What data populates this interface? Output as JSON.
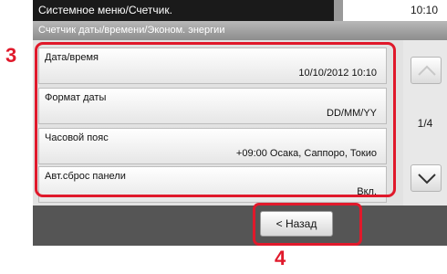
{
  "header": {
    "title": "Системное меню/Счетчик.",
    "time": "10:10",
    "subtitle": "Счетчик даты/времени/Эконом. энергии"
  },
  "settings": [
    {
      "label": "Дата/время",
      "value": "10/10/2012 10:10"
    },
    {
      "label": "Формат даты",
      "value": "DD/MM/YY"
    },
    {
      "label": "Часовой пояс",
      "value": "+09:00 Осака, Саппоро, Токио"
    },
    {
      "label": "Авт.сброс панели",
      "value": "Вкл."
    }
  ],
  "pager": {
    "text": "1/4"
  },
  "footer": {
    "back_label": "< Назад"
  },
  "callouts": {
    "list": "3",
    "back": "4"
  },
  "icons": {
    "up": "chevron-up-icon",
    "down": "chevron-down-icon"
  },
  "colors": {
    "highlight": "#e0192b",
    "title_bar": "#1a1a1a",
    "footer": "#555555"
  }
}
